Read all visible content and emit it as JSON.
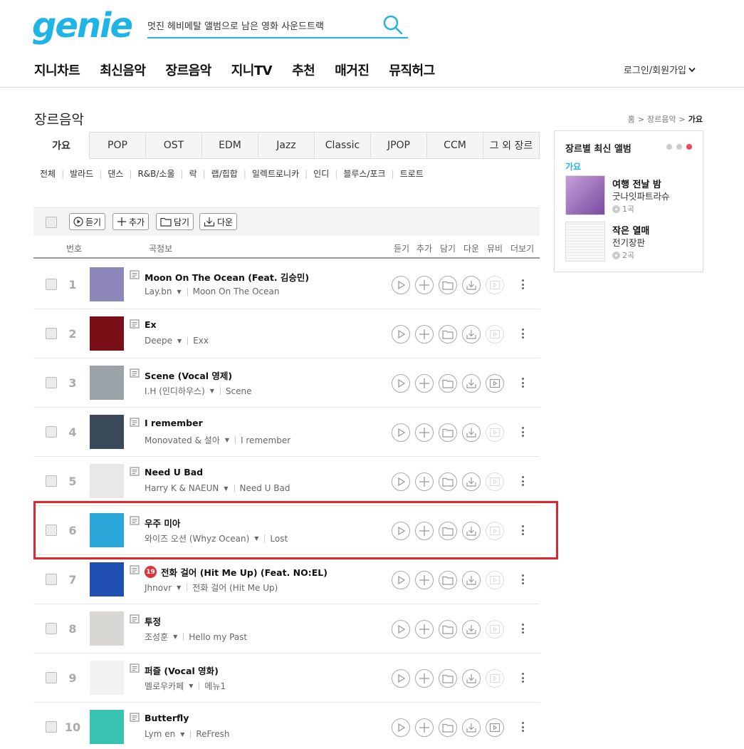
{
  "header": {
    "logo": "genie",
    "search_value": "멋진 헤비메탈 앨범으로 남은 영화 사운드트랙",
    "nav": [
      "지니차트",
      "최신음악",
      "장르음악",
      "지니TV",
      "추천",
      "매거진",
      "뮤직허그"
    ],
    "login": "로그인/회원가입"
  },
  "page": {
    "title": "장르음악",
    "breadcrumb": [
      "홈",
      "장르음악",
      "가요"
    ]
  },
  "tabs": [
    "가요",
    "POP",
    "OST",
    "EDM",
    "Jazz",
    "Classic",
    "JPOP",
    "CCM",
    "그 외 장르"
  ],
  "subgenres": [
    "전체",
    "발라드",
    "댄스",
    "R&B/소울",
    "락",
    "랩/힙합",
    "일렉트로니카",
    "인디",
    "블루스/포크",
    "트로트"
  ],
  "toolbar": {
    "listen": "듣기",
    "add": "추가",
    "save": "담기",
    "download": "다운"
  },
  "list_header": {
    "number": "번호",
    "info": "곡정보",
    "listen": "듣기",
    "add": "추가",
    "save": "담기",
    "download": "다운",
    "mv": "뮤비",
    "more": "더보기"
  },
  "tracks": [
    {
      "rank": "1",
      "title": "Moon On The Ocean (Feat. 김승민)",
      "artist": "Lay.bn",
      "album": "Moon On The Ocean",
      "cover": "#8d86b8",
      "adult": false,
      "mv": false
    },
    {
      "rank": "2",
      "title": "Ex",
      "artist": "Deepe",
      "album": "Exx",
      "cover": "#7a0f18",
      "adult": false,
      "mv": false
    },
    {
      "rank": "3",
      "title": "Scene (Vocal 영제)",
      "artist": "I.H (인디하우스)",
      "album": "Scene",
      "cover": "#9aa4a8",
      "adult": false,
      "mv": true
    },
    {
      "rank": "4",
      "title": "I remember",
      "artist": "Monovated & 설아",
      "album": "I remember",
      "cover": "#3a4a5a",
      "adult": false,
      "mv": false
    },
    {
      "rank": "5",
      "title": "Need U Bad",
      "artist": "Harry K & NAEUN",
      "album": "Need U Bad",
      "cover": "#e8e8e8",
      "adult": false,
      "mv": false
    },
    {
      "rank": "6",
      "title": "우주 미아",
      "artist": "와이즈 오션 (Whyz Ocean)",
      "album": "Lost",
      "cover": "#2aa6d9",
      "adult": false,
      "mv": false
    },
    {
      "rank": "7",
      "title": "전화 걸어 (Hit Me Up) (Feat. NO:EL)",
      "artist": "Jhnovr",
      "album": "전화 걸어 (Hit Me Up)",
      "cover": "#1f4fb0",
      "adult": true,
      "adult_label": "19",
      "mv": false
    },
    {
      "rank": "8",
      "title": "투정",
      "artist": "조성훈",
      "album": "Hello my Past",
      "cover": "#d8d6d2",
      "adult": false,
      "mv": false
    },
    {
      "rank": "9",
      "title": "퍼즐 (Vocal 영화)",
      "artist": "멜로우카페",
      "album": "메뉴1",
      "cover": "#f2f2f2",
      "adult": false,
      "mv": false
    },
    {
      "rank": "10",
      "title": "Butterfly",
      "artist": "Lym en",
      "album": "ReFresh",
      "cover": "#38c2b0",
      "adult": false,
      "mv": true
    }
  ],
  "sidebar": {
    "title": "장르별 최신 앨범",
    "genre": "가요",
    "albums": [
      {
        "title": "여행 전날 밤",
        "artist": "굿나잇파트라슈",
        "count": "1곡",
        "cover": "#9c6bb0"
      },
      {
        "title": "작은 열매",
        "artist": "전기장판",
        "count": "2곡",
        "cover": "#f4f4f4"
      }
    ]
  }
}
